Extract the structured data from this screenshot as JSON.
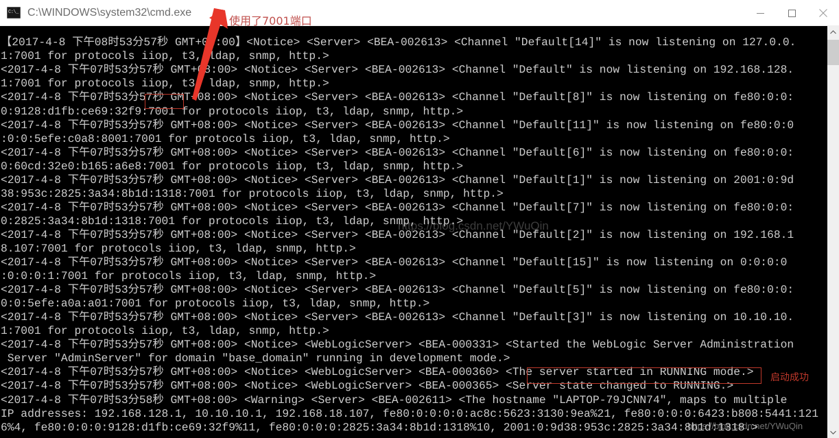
{
  "window": {
    "title": "C:\\WINDOWS\\system32\\cmd.exe",
    "icon": "cmd-icon",
    "minimize_label": "—",
    "maximize_label": "☐",
    "close_label": "✕"
  },
  "annotations": {
    "port_note": "使用了7001端口",
    "success_note": "启动成功",
    "arrow_color": "#e8362a",
    "highlight_color": "#c0392b",
    "note_color": "#c0504d"
  },
  "watermarks": {
    "middle": "https://blog.csdn.net/YWuQin",
    "bottom": "https://blog.csdn.net/YWuQin"
  },
  "console": {
    "background": "#000000",
    "foreground": "#cccccc",
    "text": "【2017-4-8 下午08时53分57秒 GMT+08:00】<Notice> <Server> <BEA-002613> <Channel \"Default[14]\" is now listening on 127.0.0.\n1:7001 for protocols iiop, t3, ldap, snmp, http.>\n<2017-4-8 下午07时53分57秒 GMT+08:00> <Notice> <Server> <BEA-002613> <Channel \"Default\" is now listening on 192.168.128.\n1:7001 for protocols iiop, t3, ldap, snmp, http.>\n<2017-4-8 下午07时53分57秒 GMT+08:00> <Notice> <Server> <BEA-002613> <Channel \"Default[8]\" is now listening on fe80:0:0:\n0:9128:d1fb:ce69:32f9:7001 for protocols iiop, t3, ldap, snmp, http.>\n<2017-4-8 下午07时53分57秒 GMT+08:00> <Notice> <Server> <BEA-002613> <Channel \"Default[11]\" is now listening on fe80:0:0\n:0:0:5efe:c0a8:8001:7001 for protocols iiop, t3, ldap, snmp, http.>\n<2017-4-8 下午07时53分57秒 GMT+08:00> <Notice> <Server> <BEA-002613> <Channel \"Default[6]\" is now listening on fe80:0:0:\n0:60cd:32e0:b165:a6e8:7001 for protocols iiop, t3, ldap, snmp, http.>\n<2017-4-8 下午07时53分57秒 GMT+08:00> <Notice> <Server> <BEA-002613> <Channel \"Default[1]\" is now listening on 2001:0:9d\n38:953c:2825:3a34:8b1d:1318:7001 for protocols iiop, t3, ldap, snmp, http.>\n<2017-4-8 下午07时53分57秒 GMT+08:00> <Notice> <Server> <BEA-002613> <Channel \"Default[7]\" is now listening on fe80:0:0:\n0:2825:3a34:8b1d:1318:7001 for protocols iiop, t3, ldap, snmp, http.>\n<2017-4-8 下午07时53分57秒 GMT+08:00> <Notice> <Server> <BEA-002613> <Channel \"Default[2]\" is now listening on 192.168.1\n8.107:7001 for protocols iiop, t3, ldap, snmp, http.>\n<2017-4-8 下午07时53分57秒 GMT+08:00> <Notice> <Server> <BEA-002613> <Channel \"Default[15]\" is now listening on 0:0:0:0\n:0:0:0:1:7001 for protocols iiop, t3, ldap, snmp, http.>\n<2017-4-8 下午07时53分57秒 GMT+08:00> <Notice> <Server> <BEA-002613> <Channel \"Default[5]\" is now listening on fe80:0:0:\n0:0:5efe:a0a:a01:7001 for protocols iiop, t3, ldap, snmp, http.>\n<2017-4-8 下午07时53分57秒 GMT+08:00> <Notice> <Server> <BEA-002613> <Channel \"Default[3]\" is now listening on 10.10.10.\n1:7001 for protocols iiop, t3, ldap, snmp, http.>\n<2017-4-8 下午07时53分57秒 GMT+08:00> <Notice> <WebLogicServer> <BEA-000331> <Started the WebLogic Server Administration\n Server \"AdminServer\" for domain \"base_domain\" running in development mode.>\n<2017-4-8 下午07时53分57秒 GMT+08:00> <Notice> <WebLogicServer> <BEA-000360> <The server started in RUNNING mode.>\n<2017-4-8 下午07时53分57秒 GMT+08:00> <Notice> <WebLogicServer> <BEA-000365> <Server state changed to RUNNING.>\n<2017-4-8 下午07时53分58秒 GMT+08:00> <Warning> <Server> <BEA-002611> <The hostname \"LAPTOP-79JCNN74\", maps to multiple\nIP addresses: 192.168.128.1, 10.10.10.1, 192.168.18.107, fe80:0:0:0:0:ac8c:5623:3130:9ea%21, fe80:0:0:0:6423:b808:5441:121\n6%4, fe80:0:0:0:9128:d1fb:ce69:32f9%11, fe80:0:0:0:2825:3a34:8b1d:1318%10, 2001:0:9d38:953c:2825:3a34:8b1d:1318.>"
  },
  "scrollbar": {
    "up_arrow": "⌃",
    "down_arrow": "⌄"
  }
}
